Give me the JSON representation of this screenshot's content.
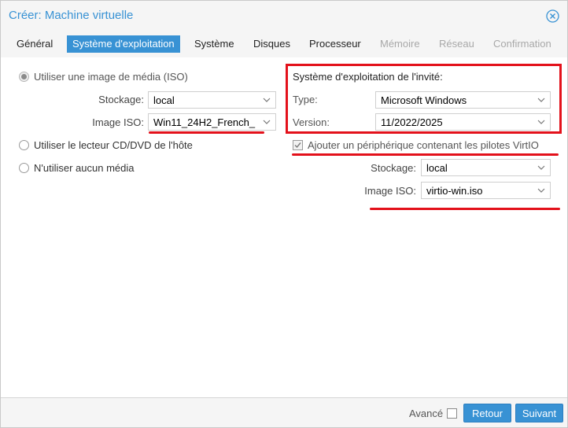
{
  "dialog": {
    "title": "Créer: Machine virtuelle"
  },
  "tabs": [
    {
      "label": "Général"
    },
    {
      "label": "Système d'exploitation"
    },
    {
      "label": "Système"
    },
    {
      "label": "Disques"
    },
    {
      "label": "Processeur"
    },
    {
      "label": "Mémoire"
    },
    {
      "label": "Réseau"
    },
    {
      "label": "Confirmation"
    }
  ],
  "media": {
    "option_iso": "Utiliser une image de média (ISO)",
    "storage_label": "Stockage:",
    "storage_value": "local",
    "iso_label": "Image ISO:",
    "iso_value": "Win11_24H2_French_",
    "option_cd": "Utiliser le lecteur CD/DVD de l'hôte",
    "option_none": "N'utiliser aucun média"
  },
  "guest_os": {
    "heading": "Système d'exploitation de l'invité:",
    "type_label": "Type:",
    "type_value": "Microsoft Windows",
    "version_label": "Version:",
    "version_value": "11/2022/2025"
  },
  "virtio": {
    "checkbox_label": "Ajouter un périphérique contenant les pilotes VirtIO",
    "checked": true,
    "storage_label": "Stockage:",
    "storage_value": "local",
    "iso_label": "Image ISO:",
    "iso_value": "virtio-win.iso"
  },
  "footer": {
    "advanced_label": "Avancé",
    "back_label": "Retour",
    "next_label": "Suivant"
  },
  "colors": {
    "accent": "#3892d4",
    "highlight": "#e3111b"
  }
}
